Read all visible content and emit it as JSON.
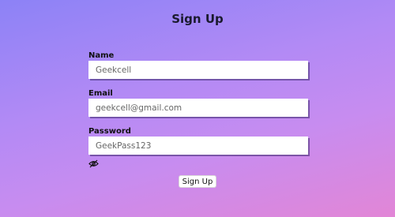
{
  "form": {
    "title": "Sign Up",
    "fields": [
      {
        "label": "Name",
        "value": "Geekcell"
      },
      {
        "label": "Email",
        "value": "geekcell@gmail.com"
      },
      {
        "label": "Password",
        "value": "GeekPass123"
      }
    ],
    "password_toggle_icon": "eye-slash-icon",
    "submit_label": "Sign Up"
  },
  "colors": {
    "background_start": "#8c82f6",
    "background_end": "#e286d6"
  }
}
